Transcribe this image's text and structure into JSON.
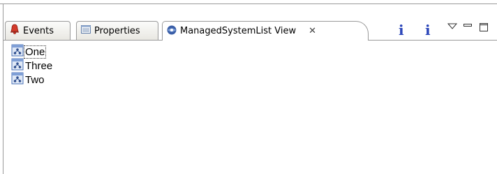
{
  "tabs": [
    {
      "label": "Events",
      "icon": "bell-icon",
      "active": false
    },
    {
      "label": "Properties",
      "icon": "properties-icon",
      "active": false
    },
    {
      "label": "ManagedSystemList View",
      "icon": "managed-system-icon",
      "active": true,
      "close_glyph": "✕"
    }
  ],
  "toolbar": {
    "info1": "i",
    "info2": "i"
  },
  "tree": {
    "items": [
      {
        "label": "One",
        "icon": "system-node-icon",
        "focused": true
      },
      {
        "label": "Three",
        "icon": "system-node-icon",
        "focused": false
      },
      {
        "label": "Two",
        "icon": "system-node-icon",
        "focused": false
      }
    ]
  },
  "colors": {
    "info_icon": "#2a45b9",
    "node_icon_border": "#4a6fb5",
    "bell_red": "#d23a2a"
  }
}
